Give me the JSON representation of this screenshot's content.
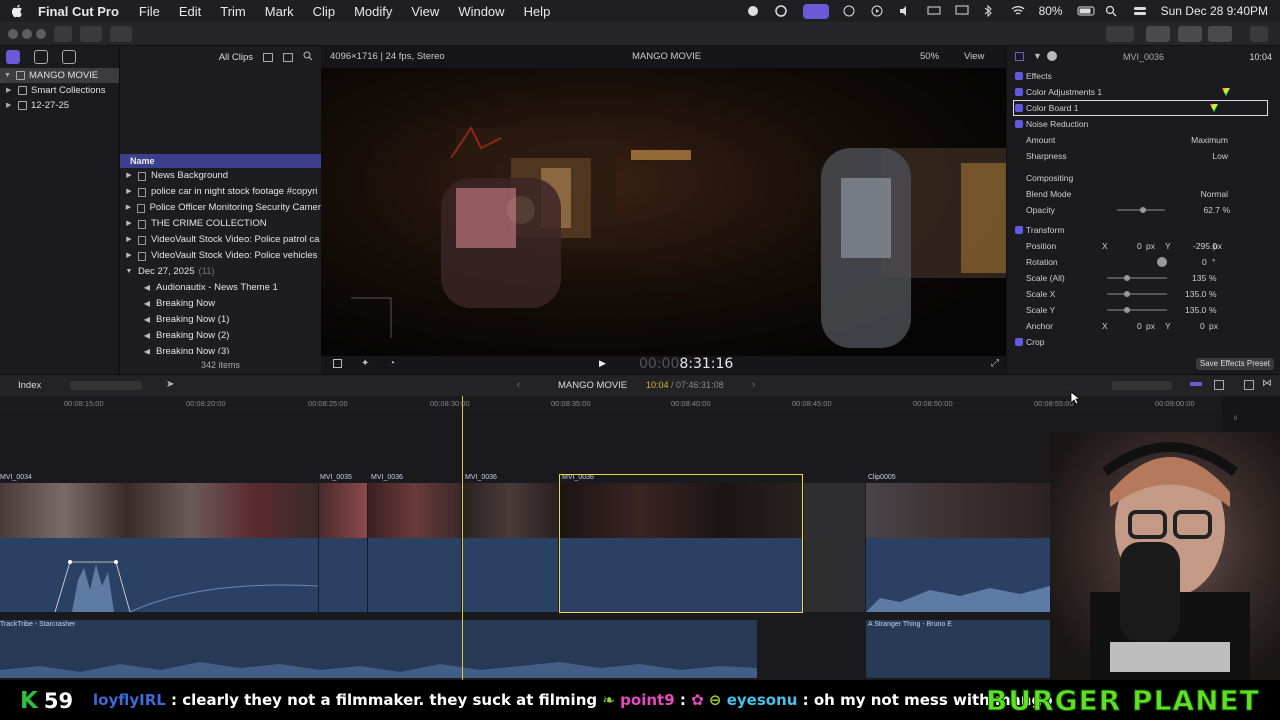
{
  "menubar": {
    "app_name": "Final Cut Pro",
    "menus": [
      "File",
      "Edit",
      "Trim",
      "Mark",
      "Clip",
      "Modify",
      "View",
      "Window",
      "Help"
    ],
    "battery": "80%",
    "datetime": "Sun Dec 28  9:40PM"
  },
  "library": {
    "name": "MANGO MOVIE",
    "smart_collections": "Smart Collections",
    "event": "12-27-25"
  },
  "browser": {
    "filter": "All Clips",
    "name_header": "Name",
    "rows": [
      {
        "type": "folder",
        "label": "News Background"
      },
      {
        "type": "clip",
        "label": "police  car in night stock footage #copyri"
      },
      {
        "type": "clip",
        "label": "Police Officer Monitoring Security Camer"
      },
      {
        "type": "clip",
        "label": "THE CRIME COLLECTION"
      },
      {
        "type": "clip",
        "label": "VideoVault Stock Video:   Police patrol ca"
      },
      {
        "type": "clip",
        "label": "VideoVault Stock Video:   Police vehicles"
      }
    ],
    "group_label": "Dec 27, 2025",
    "group_count": "(11)",
    "audio_rows": [
      "Audionautix - News Theme 1",
      "Breaking Now",
      "Breaking Now (1)",
      "Breaking Now (2)",
      "Breaking Now (3)"
    ],
    "item_count": "342 items"
  },
  "viewer": {
    "format_info": "4096×1716 | 24 fps, Stereo",
    "title": "MANGO MOVIE",
    "zoom": "50%",
    "view_menu": "View",
    "timecode_dim": "00:00",
    "timecode": "8:31:16"
  },
  "inspector": {
    "clip_name": "MVI_0036",
    "duration": "10:04",
    "effects_label": "Effects",
    "color_adjustments": "Color Adjustments 1",
    "color_board": "Color Board 1",
    "noise_reduction": "Noise Reduction",
    "amount_label": "Amount",
    "amount_value": "Maximum",
    "sharpness_label": "Sharpness",
    "sharpness_value": "Low",
    "compositing": "Compositing",
    "blend_label": "Blend Mode",
    "blend_value": "Normal",
    "opacity_label": "Opacity",
    "opacity_value": "62.7",
    "pct": "%",
    "transform": "Transform",
    "position_label": "Position",
    "x_label": "X",
    "y_label": "Y",
    "pos_x": "0",
    "pos_y": "-295.0",
    "px": "px",
    "rotation_label": "Rotation",
    "rotation_value": "0",
    "deg": "°",
    "scale_all_label": "Scale (All)",
    "scale_all": "135",
    "scale_x_label": "Scale X",
    "scale_x": "135.0",
    "scale_y_label": "Scale Y",
    "scale_y": "135.0",
    "anchor_label": "Anchor",
    "anchor_x": "0",
    "anchor_y": "0",
    "crop": "Crop",
    "save_preset": "Save Effects Preset"
  },
  "timeline": {
    "index_label": "Index",
    "project": "MANGO MOVIE",
    "duration_current": "10:04",
    "duration_total": " / 07:46:31:08",
    "ruler": [
      "00:08:15:00",
      "00:08:20:00",
      "00:08:25:00",
      "00:08:30:00",
      "00:08:35:00",
      "00:08:40:00",
      "00:08:45:00",
      "00:08:50:00",
      "00:08:55:00",
      "00:09:00:00"
    ],
    "clips": [
      "MVI_0034",
      "MVI_0035",
      "MVI_0036",
      "MVI_0036",
      "MVI_0036",
      "Clip0005"
    ],
    "music_1": "TrackTribe - Starcrasher",
    "music_2": "A Stranger Thing - Bruno E"
  },
  "overlay": {
    "kudos_count": "59",
    "kudos_letter": "K",
    "chat_user1": "loyflyIRL",
    "chat_msg1": " : clearly they not a filmmaker. they suck at filming ",
    "chat_user2": "point9",
    "chat_msg2": " :  ",
    "chat_user3": "eyesonu",
    "chat_msg3": " : oh my not mess with mango",
    "brand": "BURGER PLANET"
  }
}
